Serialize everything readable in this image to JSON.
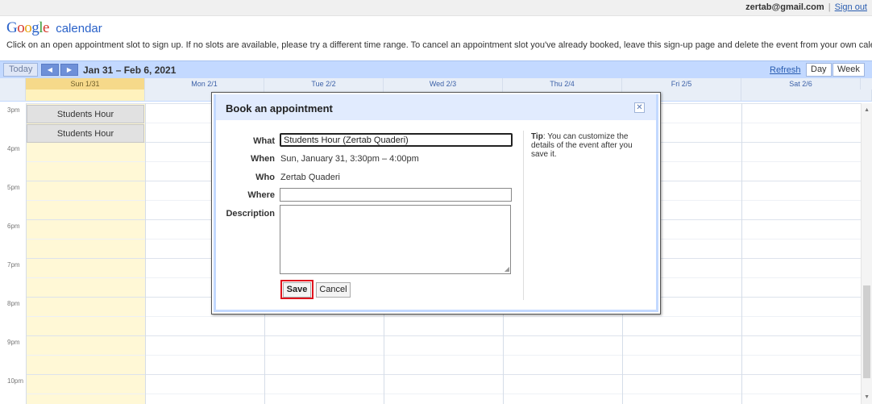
{
  "account": {
    "email": "zertab@gmail.com",
    "sep": "|",
    "sign_out": "Sign out"
  },
  "logo": {
    "google": [
      "G",
      "o",
      "o",
      "g",
      "l",
      "e"
    ],
    "product": "calendar"
  },
  "instructions": "Click on an open appointment slot to sign up. If no slots are available, please try a different time range. To cancel an appointment slot you've already booked, leave this sign-up page and delete the event from your own calendar.",
  "toolbar": {
    "today": "Today",
    "prev_icon": "◀",
    "next_icon": "▶",
    "date_range": "Jan 31 – Feb 6, 2021",
    "refresh": "Refresh",
    "views": [
      "Day",
      "Week"
    ]
  },
  "days": [
    "Sun 1/31",
    "Mon 2/1",
    "Tue 2/2",
    "Wed 2/3",
    "Thu 2/4",
    "Fri 2/5",
    "Sat 2/6"
  ],
  "times": [
    "3pm",
    "4pm",
    "5pm",
    "6pm",
    "7pm",
    "8pm",
    "9pm",
    "10pm"
  ],
  "slots": [
    "Students Hour",
    "Students Hour"
  ],
  "dialog": {
    "title": "Book an appointment",
    "close_icon": "✕",
    "what_label": "What",
    "what_value": "Students Hour (Zertab Quaderi)",
    "when_label": "When",
    "when_value": "Sun, January 31, 3:30pm – 4:00pm",
    "who_label": "Who",
    "who_value": "Zertab Quaderi",
    "where_label": "Where",
    "where_value": "",
    "description_label": "Description",
    "description_value": "",
    "save": "Save",
    "cancel": "Cancel",
    "tip_bold": "Tip",
    "tip_text": ": You can customize the details of the event after you save it."
  },
  "colors": {
    "accent": "#c3d9ff",
    "today_header": "#f6d98a",
    "today_column": "#fff8d6",
    "highlight": "#e0141e"
  }
}
